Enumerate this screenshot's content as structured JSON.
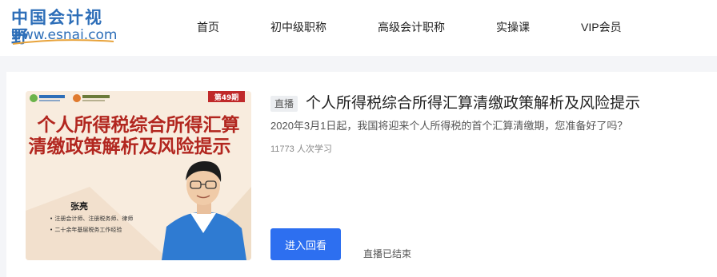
{
  "header": {
    "logo_cn": "中国会计视野",
    "logo_url": "www.esnai.com",
    "nav": [
      "首页",
      "初中级职称",
      "高级会计职称",
      "实操课",
      "VIP会员"
    ]
  },
  "course": {
    "badge": "直播",
    "title": "个人所得税综合所得汇算清缴政策解析及风险提示",
    "description": "2020年3月1日起，我国将迎来个人所得税的首个汇算清缴期，您准备好了吗？",
    "learners": "11773 人次学习",
    "button_label": "进入回看",
    "status": "直播已结束",
    "cover": {
      "issue": "第49期",
      "title_line1": "个人所得税综合所得汇算",
      "title_line2": "清缴政策解析及风险提示",
      "speaker": "张亮",
      "credentials": [
        "• 注册会计师、注册税务师、律师",
        "• 二十余年基层税务工作经验"
      ],
      "colors": {
        "title": "#b2261f",
        "issue_bg": "#c0292a",
        "panel": "#1f6fcf"
      }
    }
  }
}
